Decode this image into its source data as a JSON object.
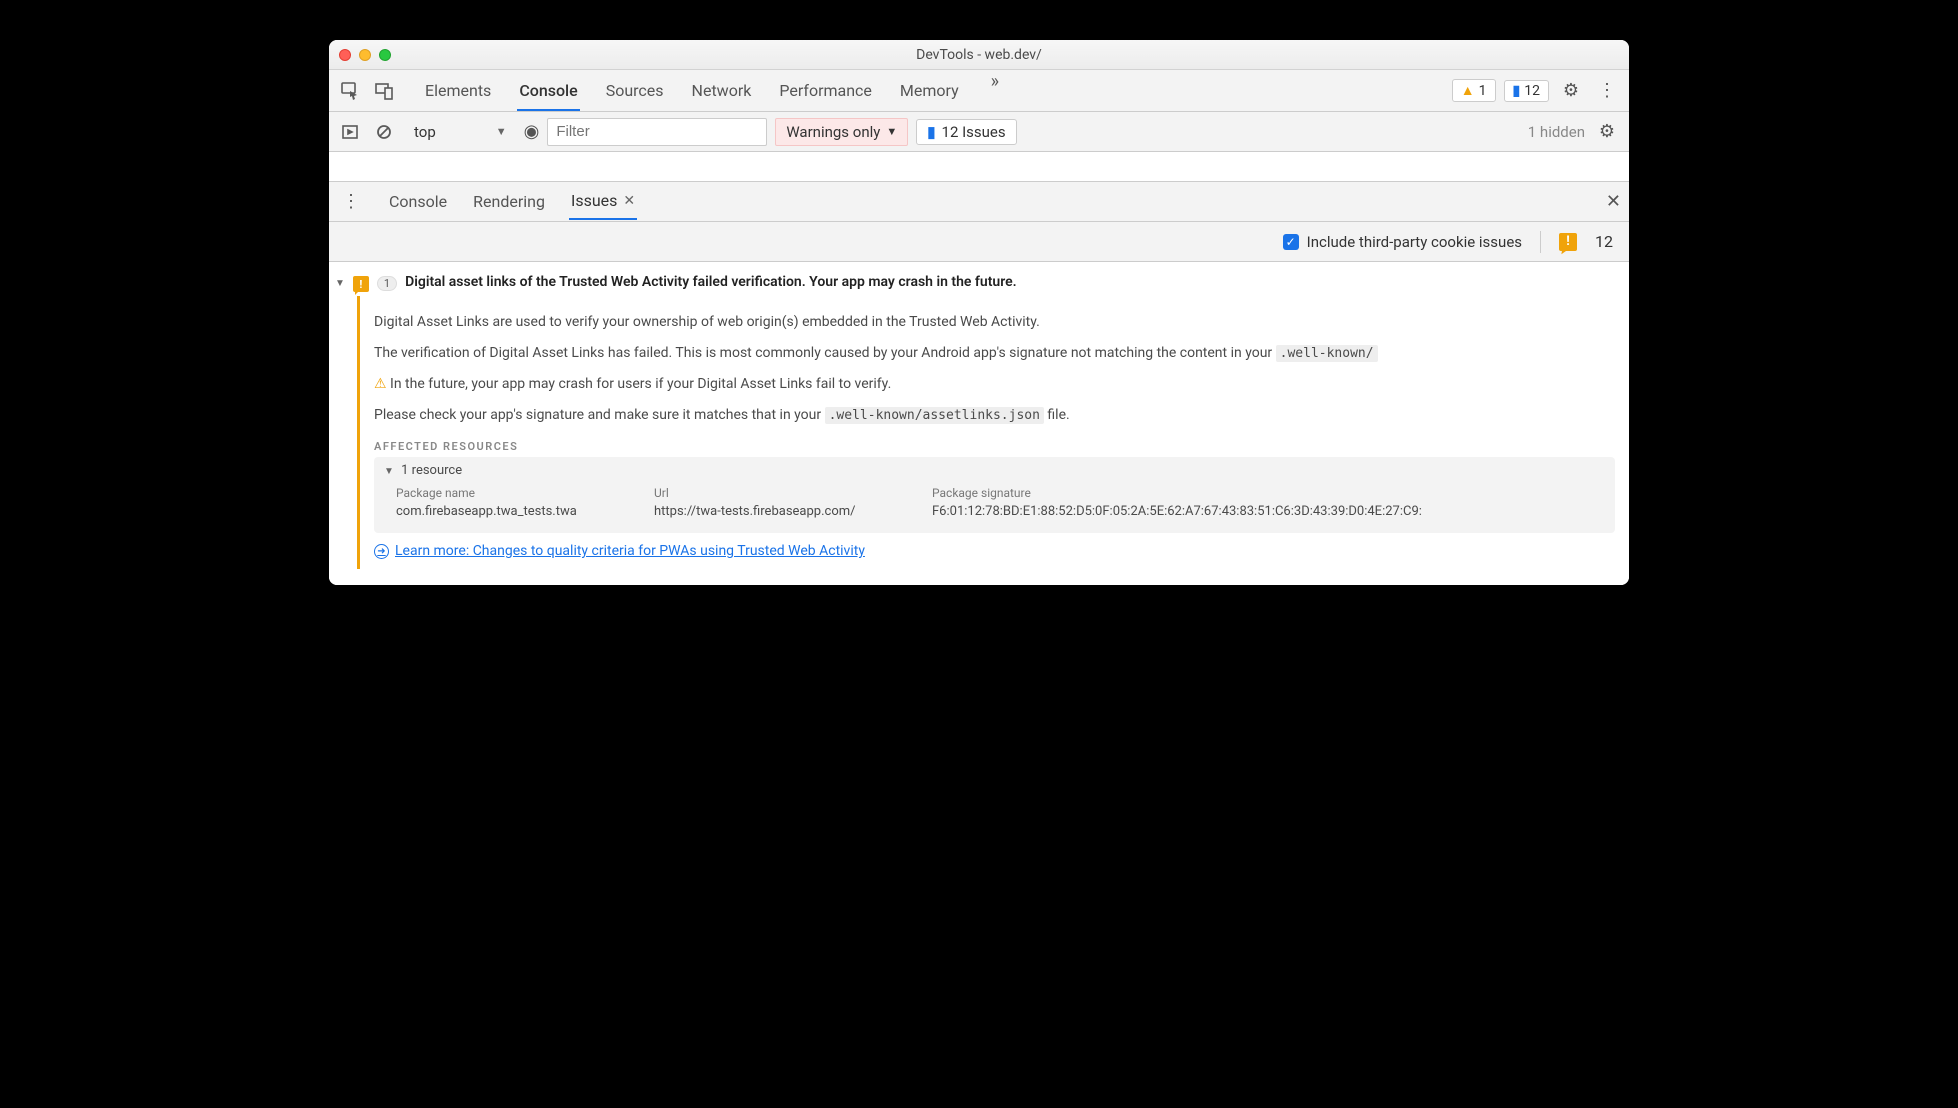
{
  "window": {
    "title": "DevTools - web.dev/"
  },
  "mainTabs": {
    "items": [
      "Elements",
      "Console",
      "Sources",
      "Network",
      "Performance",
      "Memory"
    ],
    "active": "Console",
    "warnCount": "1",
    "msgCount": "12"
  },
  "filterBar": {
    "context": "top",
    "placeholder": "Filter",
    "level": "Warnings only",
    "issuesBtn": "12 Issues",
    "hidden": "1 hidden"
  },
  "drawer": {
    "tabs": [
      "Console",
      "Rendering",
      "Issues"
    ],
    "active": "Issues",
    "opt_label": "Include third-party cookie issues",
    "count": "12"
  },
  "issue": {
    "count": "1",
    "title": "Digital asset links of the Trusted Web Activity failed verification. Your app may crash in the future.",
    "p1": "Digital Asset Links are used to verify your ownership of web origin(s) embedded in the Trusted Web Activity.",
    "p2a": "The verification of Digital Asset Links has failed. This is most commonly caused by your Android app's signature not matching the content in your ",
    "p2code": ".well-known/",
    "p3": "In the future, your app may crash for users if your Digital Asset Links fail to verify.",
    "p4a": "Please check your app's signature and make sure it matches that in your ",
    "p4code": ".well-known/assetlinks.json",
    "p4b": " file.",
    "section": "Affected Resources",
    "resCount": "1 resource",
    "th1": "Package name",
    "th2": "Url",
    "th3": "Package signature",
    "td1": "com.firebaseapp.twa_tests.twa",
    "td2": "https://twa-tests.firebaseapp.com/",
    "td3": "F6:01:12:78:BD:E1:88:52:D5:0F:05:2A:5E:62:A7:67:43:83:51:C6:3D:43:39:D0:4E:27:C9:",
    "learn": "Learn more: Changes to quality criteria for PWAs using Trusted Web Activity"
  }
}
